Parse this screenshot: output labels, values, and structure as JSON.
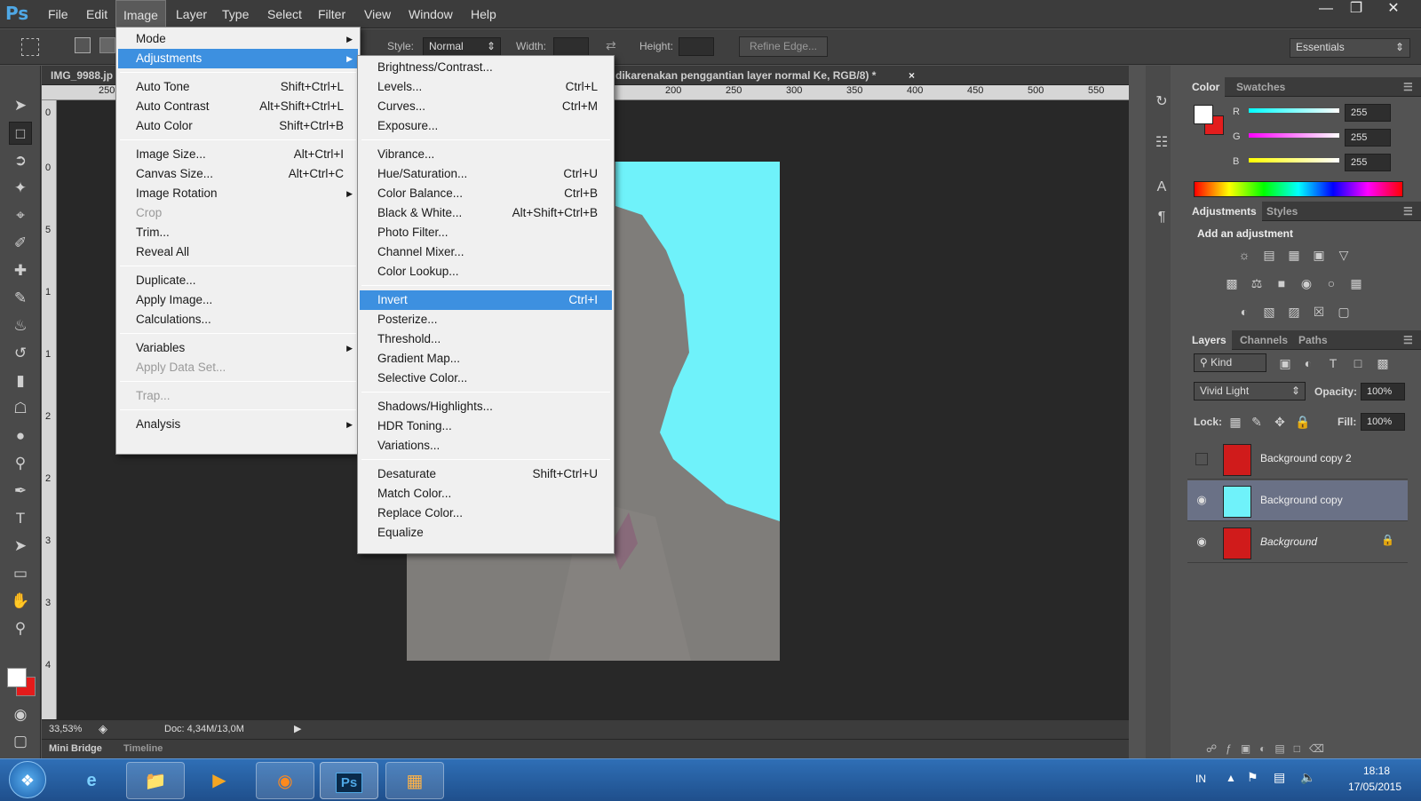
{
  "app": {
    "logo": "Ps"
  },
  "menubar": {
    "items": [
      "File",
      "Edit",
      "Image",
      "Layer",
      "Type",
      "Select",
      "Filter",
      "View",
      "Window",
      "Help"
    ],
    "active": "Image"
  },
  "window_controls": {
    "minimize_icon": "minimize-icon",
    "restore_icon": "restore-icon",
    "close_icon": "close-icon"
  },
  "options": {
    "style_label": "Style:",
    "style_value": "Normal",
    "width_label": "Width:",
    "height_label": "Height:",
    "refine_edge": "Refine Edge...",
    "workspace": "Essentials"
  },
  "doc": {
    "tab_left": "IMG_9988.jp",
    "tab_right": "dikarenakan penggantian layer normal Ke, RGB/8) *",
    "tab_close": "×",
    "ruler_top_labels": [
      "250",
      "200",
      "250",
      "300",
      "350",
      "400",
      "450",
      "500",
      "550"
    ],
    "ruler_left_labels": [
      "0",
      "0",
      "5",
      "1",
      "1",
      "2",
      "2",
      "3",
      "3",
      "4"
    ],
    "zoom": "33,53%",
    "doc_size": "Doc: 4,34M/13,0M"
  },
  "bottom_tabs": {
    "mini_bridge": "Mini Bridge",
    "timeline": "Timeline"
  },
  "image_menu": {
    "items": [
      {
        "label": "Mode",
        "submenu": true
      },
      {
        "label": "Adjustments",
        "submenu": true,
        "highlight": true
      },
      {
        "label": "Auto Tone",
        "shortcut": "Shift+Ctrl+L"
      },
      {
        "label": "Auto Contrast",
        "shortcut": "Alt+Shift+Ctrl+L"
      },
      {
        "label": "Auto Color",
        "shortcut": "Shift+Ctrl+B"
      },
      {
        "label": "Image Size...",
        "shortcut": "Alt+Ctrl+I"
      },
      {
        "label": "Canvas Size...",
        "shortcut": "Alt+Ctrl+C"
      },
      {
        "label": "Image Rotation",
        "submenu": true
      },
      {
        "label": "Crop",
        "disabled": true
      },
      {
        "label": "Trim..."
      },
      {
        "label": "Reveal All"
      },
      {
        "label": "Duplicate..."
      },
      {
        "label": "Apply Image..."
      },
      {
        "label": "Calculations..."
      },
      {
        "label": "Variables",
        "submenu": true
      },
      {
        "label": "Apply Data Set...",
        "disabled": true
      },
      {
        "label": "Trap...",
        "disabled": true
      },
      {
        "label": "Analysis",
        "submenu": true
      }
    ]
  },
  "adjust_menu": {
    "items": [
      {
        "label": "Brightness/Contrast..."
      },
      {
        "label": "Levels...",
        "shortcut": "Ctrl+L"
      },
      {
        "label": "Curves...",
        "shortcut": "Ctrl+M"
      },
      {
        "label": "Exposure..."
      },
      {
        "label": "Vibrance..."
      },
      {
        "label": "Hue/Saturation...",
        "shortcut": "Ctrl+U"
      },
      {
        "label": "Color Balance...",
        "shortcut": "Ctrl+B"
      },
      {
        "label": "Black & White...",
        "shortcut": "Alt+Shift+Ctrl+B"
      },
      {
        "label": "Photo Filter..."
      },
      {
        "label": "Channel Mixer..."
      },
      {
        "label": "Color Lookup..."
      },
      {
        "label": "Invert",
        "shortcut": "Ctrl+I",
        "highlight": true
      },
      {
        "label": "Posterize..."
      },
      {
        "label": "Threshold..."
      },
      {
        "label": "Gradient Map..."
      },
      {
        "label": "Selective Color..."
      },
      {
        "label": "Shadows/Highlights..."
      },
      {
        "label": "HDR Toning..."
      },
      {
        "label": "Variations..."
      },
      {
        "label": "Desaturate",
        "shortcut": "Shift+Ctrl+U"
      },
      {
        "label": "Match Color..."
      },
      {
        "label": "Replace Color..."
      },
      {
        "label": "Equalize"
      }
    ]
  },
  "color_panel": {
    "tabs": [
      "Color",
      "Swatches"
    ],
    "r_label": "R",
    "g_label": "G",
    "b_label": "B",
    "r": "255",
    "g": "255",
    "b": "255"
  },
  "adjustments_panel": {
    "tabs": [
      "Adjustments",
      "Styles"
    ],
    "heading": "Add an adjustment"
  },
  "layers_panel": {
    "tabs": [
      "Layers",
      "Channels",
      "Paths"
    ],
    "kind": "Kind",
    "blend_mode": "Vivid Light",
    "opacity_label": "Opacity:",
    "opacity": "100%",
    "lock_label": "Lock:",
    "fill_label": "Fill:",
    "fill": "100%",
    "layers": [
      {
        "name": "Background copy 2",
        "visible": false,
        "selected": false
      },
      {
        "name": "Background copy",
        "visible": true,
        "selected": true
      },
      {
        "name": "Background",
        "visible": true,
        "selected": false,
        "locked": true
      }
    ]
  },
  "taskbar": {
    "language": "IN",
    "time": "18:18",
    "date": "17/05/2015"
  },
  "colors": {
    "accent": "#3d90e0",
    "cyan_bg": "#6ff2fa"
  }
}
